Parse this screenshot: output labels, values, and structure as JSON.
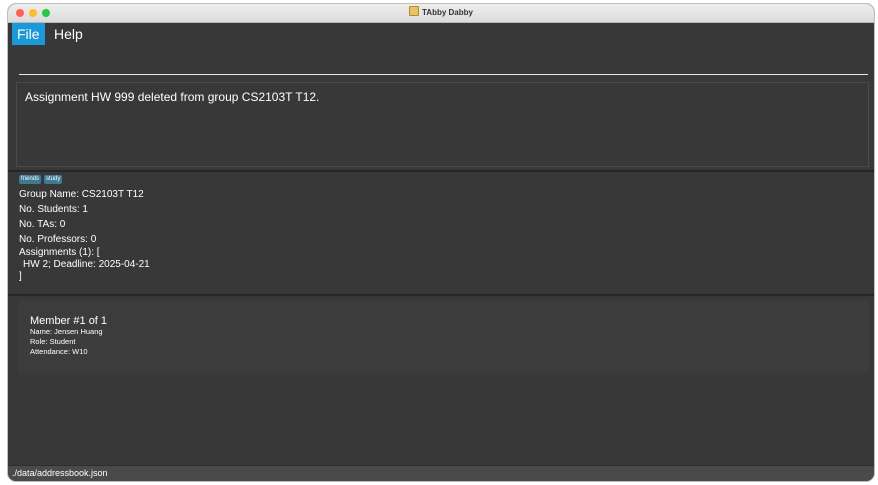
{
  "window": {
    "title": "TAbby Dabby"
  },
  "menu": {
    "file": "File",
    "help": "Help"
  },
  "command": {
    "value": ""
  },
  "result": {
    "message": "Assignment HW 999 deleted from group CS2103T T12."
  },
  "group": {
    "tags": [
      "friends",
      "study"
    ],
    "name_line": "Group Name: CS2103T T12",
    "students_line": "No. Students: 1",
    "tas_line": "No. TAs: 0",
    "professors_line": "No. Professors: 0",
    "assignments_header": "Assignments (1): [",
    "assignments": [
      "HW 2; Deadline: 2025-04-21"
    ],
    "assignments_close": "]"
  },
  "members": [
    {
      "title": "Member #1 of 1",
      "name_line": "Name: Jensen Huang",
      "role_line": "Role: Student",
      "attendance_line": "Attendance: W10"
    }
  ],
  "status": {
    "path": "./data/addressbook.json"
  },
  "colors": {
    "background": "#383838",
    "menu_highlight": "#1b98d7",
    "tag": "#3e7b91",
    "traffic_close": "#fe5f57",
    "traffic_minimize": "#febc2e",
    "traffic_maximize": "#28c840"
  },
  "icons": {
    "app": "app-icon"
  }
}
